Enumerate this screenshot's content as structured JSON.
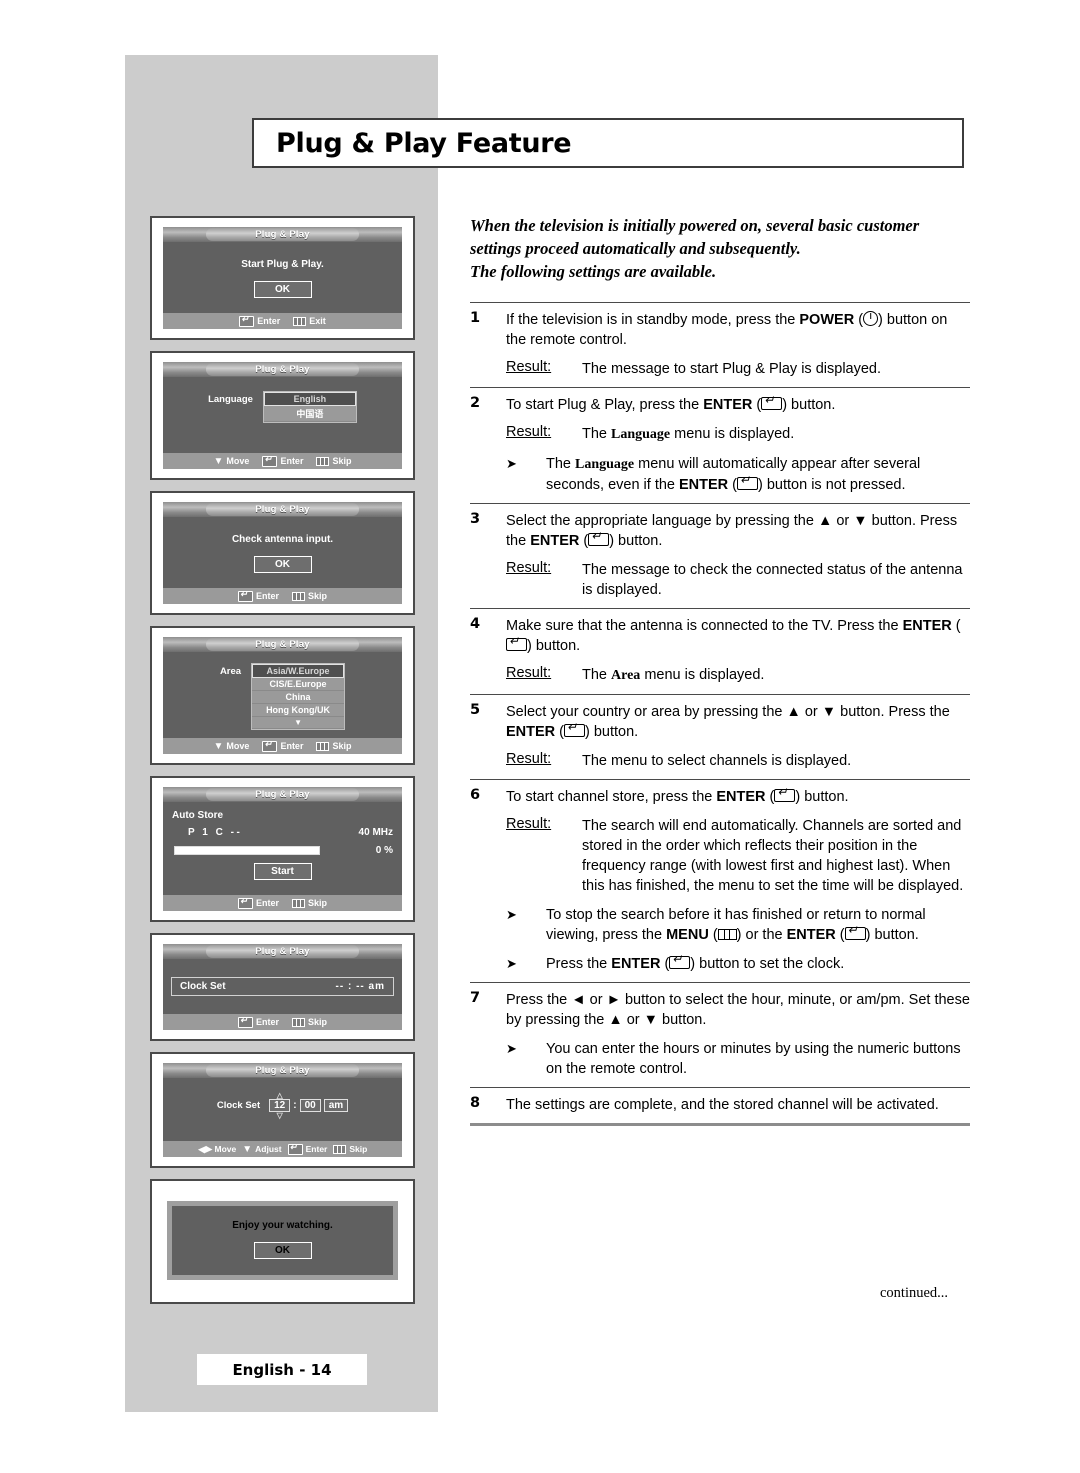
{
  "page": {
    "title": "Plug & Play Feature",
    "page_label": "English - 14",
    "continued": "continued..."
  },
  "intro": {
    "line1": "When the television is initially powered on, several basic customer",
    "line2": "settings proceed automatically and subsequently.",
    "line3": "The following settings are available."
  },
  "labels": {
    "result": "Result:",
    "osd_title": "Plug & Play",
    "hint_enter": "Enter",
    "hint_exit": "Exit",
    "hint_skip": "Skip",
    "hint_move": "Move",
    "hint_adjust": "Adjust",
    "ok": "OK",
    "start": "Start"
  },
  "osd_screens": [
    {
      "id": "start",
      "title": "Plug & Play",
      "message": "Start Plug & Play.",
      "button": "OK",
      "hints": [
        "Enter",
        "Exit"
      ]
    },
    {
      "id": "language",
      "title": "Plug & Play",
      "row_label": "Language",
      "options": [
        "English",
        "中国语"
      ],
      "selected": "English",
      "hints": [
        "Move",
        "Enter",
        "Skip"
      ]
    },
    {
      "id": "antenna",
      "title": "Plug & Play",
      "message": "Check antenna input.",
      "button": "OK",
      "hints": [
        "Enter",
        "Skip"
      ]
    },
    {
      "id": "area",
      "title": "Plug & Play",
      "row_label": "Area",
      "options": [
        "Asia/W.Europe",
        "CIS/E.Europe",
        "China",
        "Hong Kong/UK"
      ],
      "selected": "Asia/W.Europe",
      "more_arrow": "▼",
      "hints": [
        "Move",
        "Enter",
        "Skip"
      ]
    },
    {
      "id": "auto_store",
      "title": "Plug & Play",
      "heading": "Auto Store",
      "program": "P",
      "program_value": "1",
      "channel": "C",
      "channel_value": "--",
      "frequency": "40 MHz",
      "percent": "0 %",
      "button": "Start",
      "hints": [
        "Enter",
        "Skip"
      ]
    },
    {
      "id": "clock_set_empty",
      "title": "Plug & Play",
      "row_label": "Clock Set",
      "value": "-- : --  am",
      "hints": [
        "Enter",
        "Skip"
      ]
    },
    {
      "id": "clock_set_value",
      "title": "Plug & Play",
      "row_label": "Clock Set",
      "hour": "12",
      "separator": ":",
      "minute": "00",
      "meridiem": "am",
      "hints": [
        "Move",
        "Adjust",
        "Enter",
        "Skip"
      ]
    },
    {
      "id": "enjoy",
      "message": "Enjoy your watching.",
      "button": "OK"
    }
  ],
  "steps": [
    {
      "num": "1",
      "text_a": "If the television is in standby mode, press the ",
      "kw1": "POWER",
      "text_b": " (",
      "icon": "power-icon",
      "text_c": ") button on the remote control.",
      "result": "The message to start Plug & Play is displayed."
    },
    {
      "num": "2",
      "text_a": "To start Plug & Play, press the ",
      "kw1": "ENTER",
      "text_b": " (",
      "icon": "enter-icon",
      "text_c": ") button.",
      "result_a": "The ",
      "result_kw": "Language",
      "result_b": " menu is displayed.",
      "note_a": "The ",
      "note_kw": "Language",
      "note_b": " menu will automatically appear after several seconds, even if the ",
      "note_kw2": "ENTER",
      "note_c": " (",
      "note_d": ") button is not pressed."
    },
    {
      "num": "3",
      "text_a": "Select the appropriate language by pressing the ▲ or ▼ button. Press the ",
      "kw1": "ENTER",
      "text_b": " (",
      "text_c": ") button.",
      "result": "The message to check the connected status of the antenna is displayed."
    },
    {
      "num": "4",
      "text_a": "Make sure that the antenna is connected to the TV. Press the ",
      "kw1": "ENTER",
      "text_b": " (",
      "text_c": ") button.",
      "result_a": "The ",
      "result_kw": "Area",
      "result_b": " menu is displayed."
    },
    {
      "num": "5",
      "text_a": "Select your country or area by pressing the ▲ or ▼ button. Press the ",
      "kw1": "ENTER",
      "text_b": " (",
      "text_c": ") button.",
      "result": "The menu to select channels is displayed."
    },
    {
      "num": "6",
      "text_a": "To start channel store, press the ",
      "kw1": "ENTER",
      "text_b": " (",
      "text_c": ") button.",
      "result": "The search will end automatically. Channels are sorted and stored in the order which reflects their position in the frequency range (with lowest first and highest last). When this has finished, the menu to set the time will be displayed.",
      "note1_a": "To stop the search before it has finished or return to normal viewing, press the ",
      "note1_kw1": "MENU",
      "note1_b": " (",
      "note1_c": ") or the ",
      "note1_kw2": "ENTER",
      "note1_d": " (",
      "note1_e": ") button.",
      "note2_a": "Press the ",
      "note2_kw": "ENTER",
      "note2_b": " (",
      "note2_c": ") button to set the clock."
    },
    {
      "num": "7",
      "text_a": "Press the ◄ or ► button to select the hour, minute, or am/pm. Set these by pressing the ▲ or ▼ button.",
      "note": "You can enter the hours or minutes by using the numeric buttons on the remote control."
    },
    {
      "num": "8",
      "text_a": "The settings are complete, and the stored channel will be activated."
    }
  ]
}
